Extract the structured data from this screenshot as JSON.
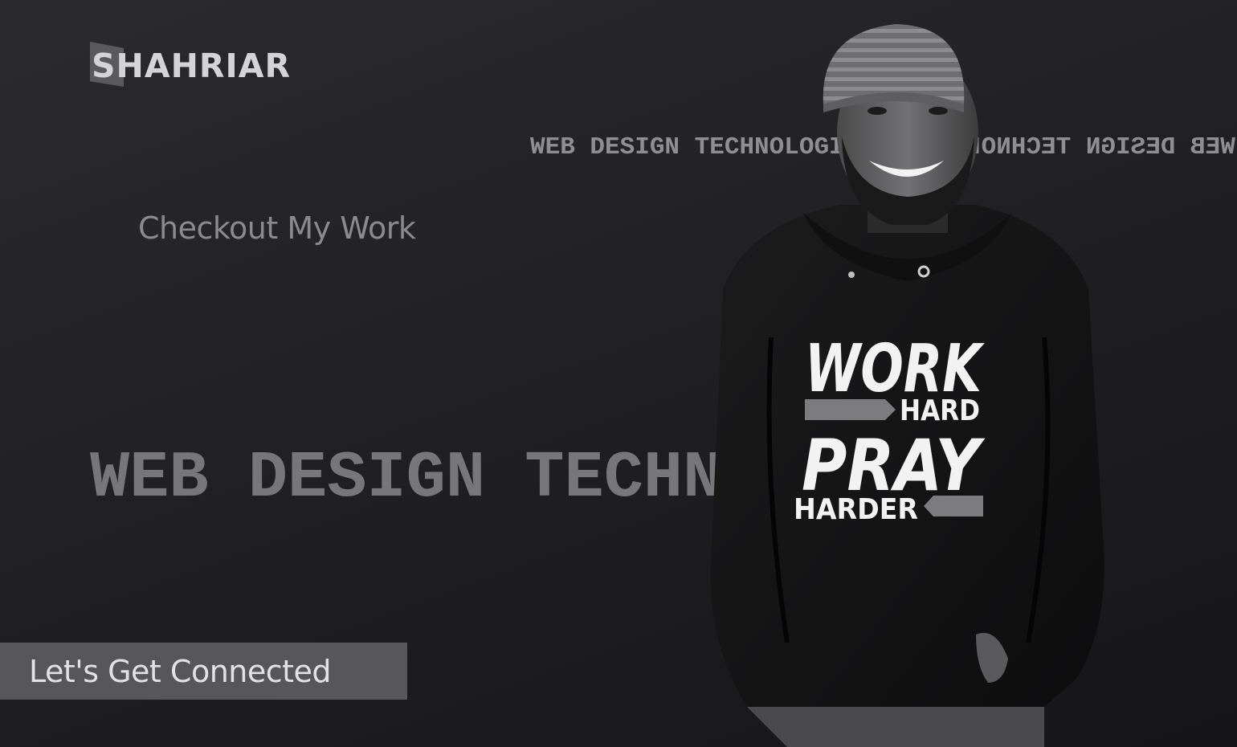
{
  "brand": {
    "logo_text": "SHAHRIAR"
  },
  "ticker": {
    "text_forward": "WEB DESIGN TECHNOLOGIST",
    "text_mirrored": "WEB DESIGN TECHNOLOGIST"
  },
  "links": {
    "checkout_label": "Checkout My Work"
  },
  "hero": {
    "headline": "WEB DESIGN TECHNOLOGIST"
  },
  "shirt": {
    "line1": "WORK",
    "line2": "HARD",
    "line3": "PRAY",
    "line4": "HARDER"
  },
  "cta": {
    "label": "Let's Get Connected"
  },
  "colors": {
    "background": "#1f1f21",
    "button": "#575759",
    "headline": "#77777b"
  }
}
